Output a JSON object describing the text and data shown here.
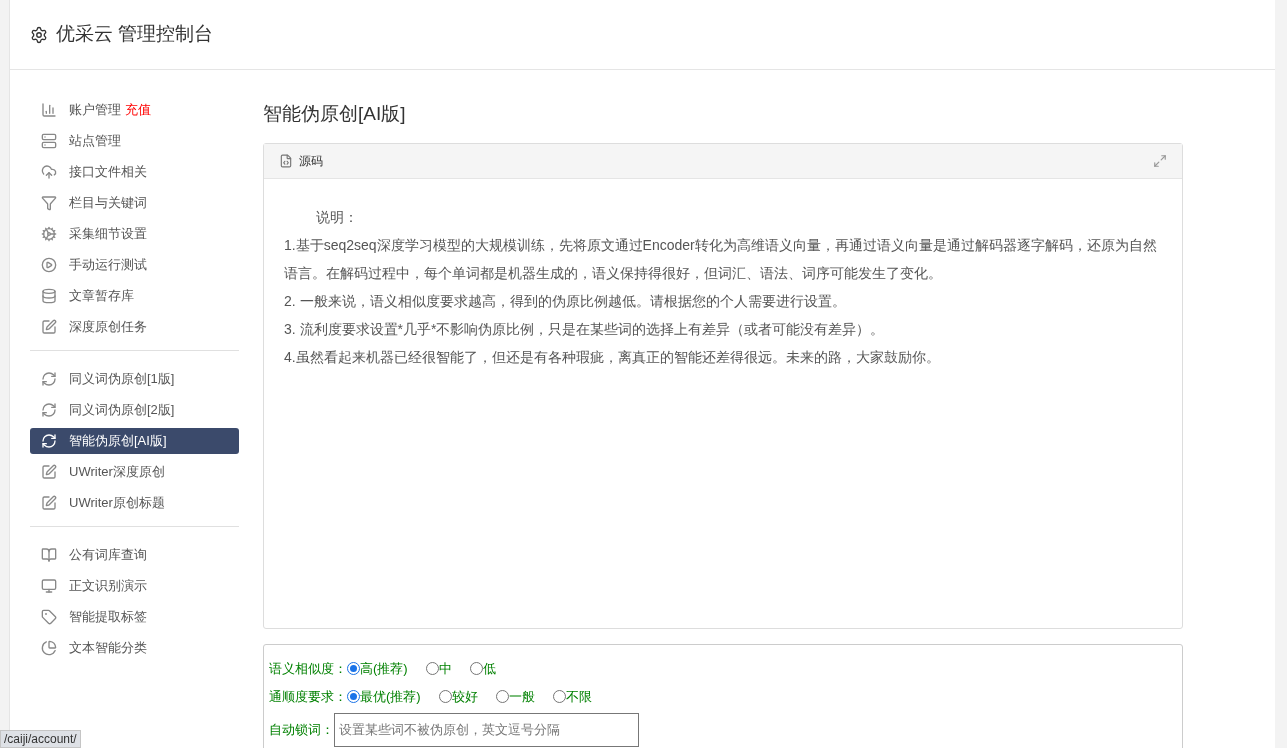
{
  "header": {
    "title": "优采云 管理控制台"
  },
  "sidebar": {
    "groups": [
      {
        "items": [
          {
            "label": "账户管理",
            "badge": "充值",
            "selected": false
          },
          {
            "label": "站点管理",
            "selected": false
          },
          {
            "label": "接口文件相关",
            "selected": false
          },
          {
            "label": "栏目与关键词",
            "selected": false
          },
          {
            "label": "采集细节设置",
            "selected": false
          },
          {
            "label": "手动运行测试",
            "selected": false
          },
          {
            "label": "文章暂存库",
            "selected": false
          },
          {
            "label": "深度原创任务",
            "selected": false
          }
        ]
      },
      {
        "items": [
          {
            "label": "同义词伪原创[1版]",
            "selected": false
          },
          {
            "label": "同义词伪原创[2版]",
            "selected": false
          },
          {
            "label": "智能伪原创[AI版]",
            "selected": true
          },
          {
            "label": "UWriter深度原创",
            "selected": false
          },
          {
            "label": "UWriter原创标题",
            "selected": false
          }
        ]
      },
      {
        "items": [
          {
            "label": "公有词库查询",
            "selected": false
          },
          {
            "label": "正文识别演示",
            "selected": false
          },
          {
            "label": "智能提取标签",
            "selected": false
          },
          {
            "label": "文本智能分类",
            "selected": false
          }
        ]
      }
    ]
  },
  "main": {
    "title": "智能伪原创[AI版]",
    "editor": {
      "toolbar_label": "源码",
      "lines": [
        "说明：",
        "1.基于seq2seq深度学习模型的大规模训练，先将原文通过Encoder转化为高维语义向量，再通过语义向量是通过解码器逐字解码，还原为自然语言。在解码过程中，每个单词都是机器生成的，语义保持得很好，但词汇、语法、词序可能发生了变化。",
        "2. 一般来说，语义相似度要求越高，得到的伪原比例越低。请根据您的个人需要进行设置。",
        "3. 流利度要求设置*几乎*不影响伪原比例，只是在某些词的选择上有差异（或者可能没有差异）。",
        "4.虽然看起来机器已经很智能了，但还是有各种瑕疵，离真正的智能还差得很远。未来的路，大家鼓励你。"
      ]
    },
    "form": {
      "radio_groups": [
        {
          "label": "语义相似度：",
          "options": [
            {
              "label": "高(推荐)",
              "selected": true
            },
            {
              "label": "中",
              "selected": false
            },
            {
              "label": "低",
              "selected": false
            }
          ]
        },
        {
          "label": "通顺度要求：",
          "options": [
            {
              "label": "最优(推荐)",
              "selected": true
            },
            {
              "label": "较好",
              "selected": false
            },
            {
              "label": "一般",
              "selected": false
            },
            {
              "label": "不限",
              "selected": false
            }
          ]
        }
      ],
      "lock_words": {
        "label": "自动锁词：",
        "placeholder": "设置某些词不被伪原创，英文逗号分隔"
      }
    }
  },
  "status_bar": {
    "url": "/caiji/account/"
  }
}
